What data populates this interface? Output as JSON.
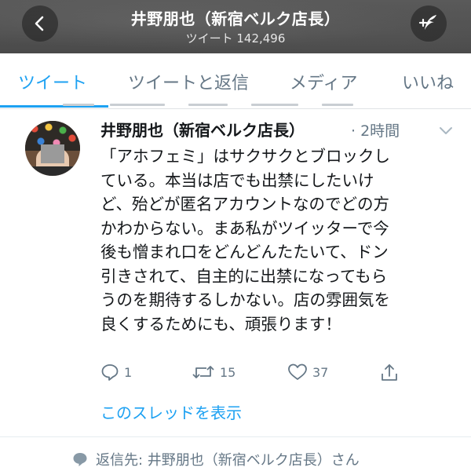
{
  "header": {
    "title": "井野朋也（新宿ベルク店長）",
    "subtitle": "ツイート 142,496",
    "back_icon": "chevron-left-icon",
    "compose_icon": "compose-feather-icon"
  },
  "tabs": [
    {
      "label": "ツイート",
      "active": true
    },
    {
      "label": "ツイートと返信",
      "active": false
    },
    {
      "label": "メディア",
      "active": false
    },
    {
      "label": "いいね",
      "active": false
    }
  ],
  "tweet": {
    "author": "井野朋也（新宿ベルク店長）",
    "time": "· 2時間",
    "text": "「アホフェミ」はサクサクとブロックし\nている。本当は店でも出禁にしたいけ\nど、殆どが匿名アカウントなのでどの方\nかわからない。まあ私がツイッターで今\n後も憎まれ口をどんどんたたいて、ドン\n引きされて、自主的に出禁になってもら\nうのを期待するしかない。店の雰囲気を\n良くするためにも、頑張ります！",
    "actions": {
      "reply_count": "1",
      "retweet_count": "15",
      "like_count": "37"
    },
    "thread_link": "このスレッドを表示"
  },
  "reply_to": "返信先: 井野朋也（新宿ベルク店長）さん",
  "colors": {
    "accent": "#1da1f2",
    "muted": "#657786",
    "text": "#14171a"
  }
}
